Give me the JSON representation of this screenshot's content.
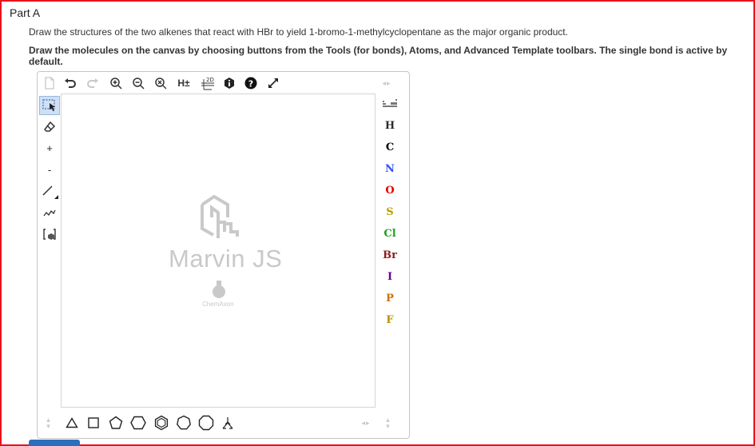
{
  "part": {
    "title": "Part A"
  },
  "question": {
    "line1": "Draw the structures of the two alkenes that react with HBr to yield 1-bromo-1-methylcyclopentane as the major organic product.",
    "line2": "Draw the molecules on the canvas by choosing buttons from the Tools (for bonds), Atoms, and Advanced Template toolbars. The single bond is active by default."
  },
  "editor": {
    "logo_text": "Marvin JS",
    "logo_sub": "ChemAxon",
    "top_toolbar": {
      "implicit_h_label": "H±",
      "clean2d_label": "2D"
    },
    "left_toolbar": {
      "charge_plus": "+",
      "charge_minus": "-"
    },
    "atoms": [
      {
        "symbol": "H",
        "color": "#2b2b2b"
      },
      {
        "symbol": "C",
        "color": "#000000"
      },
      {
        "symbol": "N",
        "color": "#3050f8"
      },
      {
        "symbol": "O",
        "color": "#e00000"
      },
      {
        "symbol": "S",
        "color": "#b8a000"
      },
      {
        "symbol": "Cl",
        "color": "#1fa01f"
      },
      {
        "symbol": "Br",
        "color": "#8b2020"
      },
      {
        "symbol": "I",
        "color": "#6a0090"
      },
      {
        "symbol": "P",
        "color": "#d07000"
      },
      {
        "symbol": "F",
        "color": "#b89000"
      }
    ]
  },
  "colors": {
    "frame": "#e8141b",
    "submit": "#2a6fbf"
  }
}
